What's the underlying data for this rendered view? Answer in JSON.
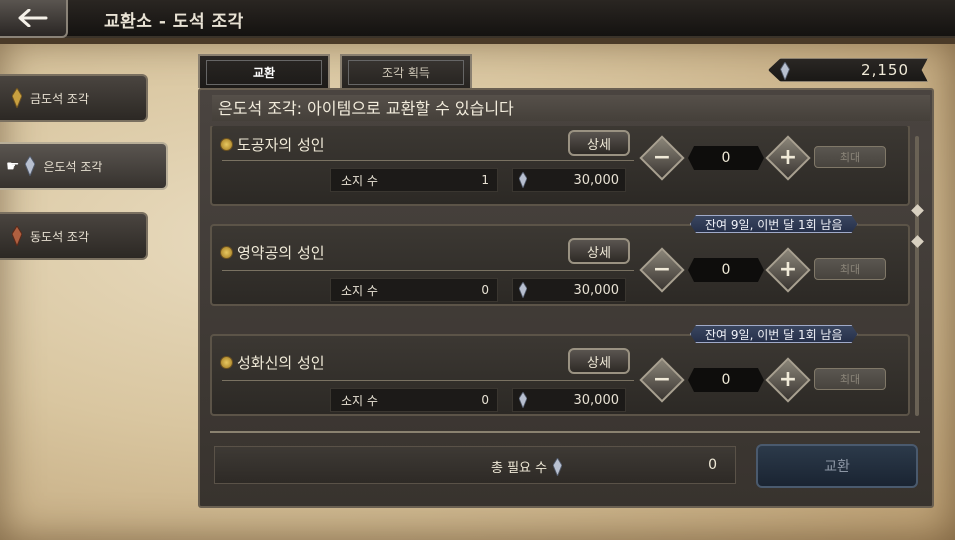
{
  "header": {
    "title": "교환소 - 도석 조각"
  },
  "categories": [
    {
      "label": "금도석 조각",
      "gem_color": "#c8a040",
      "active": false
    },
    {
      "label": "은도석 조각",
      "gem_color": "#b8c0d0",
      "active": true
    },
    {
      "label": "동도석 조각",
      "gem_color": "#b06040",
      "active": false
    }
  ],
  "tabs": [
    {
      "label": "교환",
      "active": true
    },
    {
      "label": "조각 획득",
      "active": false
    }
  ],
  "currency": {
    "amount": "2,150"
  },
  "subheader": "은도석 조각: 아이템으로 교환할 수 있습니다",
  "items": [
    {
      "name": "도공자의 성인",
      "detail_label": "상세",
      "owned_label": "소지 수",
      "owned": "1",
      "price": "30,000",
      "quantity": "0",
      "max_label": "최대",
      "limit": ""
    },
    {
      "name": "영약공의 성인",
      "detail_label": "상세",
      "owned_label": "소지 수",
      "owned": "0",
      "price": "30,000",
      "quantity": "0",
      "max_label": "최대",
      "limit": "잔여 9일, 이번 달 1회 남음"
    },
    {
      "name": "성화신의 성인",
      "detail_label": "상세",
      "owned_label": "소지 수",
      "owned": "0",
      "price": "30,000",
      "quantity": "0",
      "max_label": "최대",
      "limit": "잔여 9일, 이번 달 1회 남음"
    }
  ],
  "total": {
    "label": "총 필요 수",
    "value": "0"
  },
  "exchange_button": {
    "label": "교환"
  },
  "colors": {
    "limit_badge": "#2e3a56",
    "exchange_button": "#1f2c3c"
  }
}
